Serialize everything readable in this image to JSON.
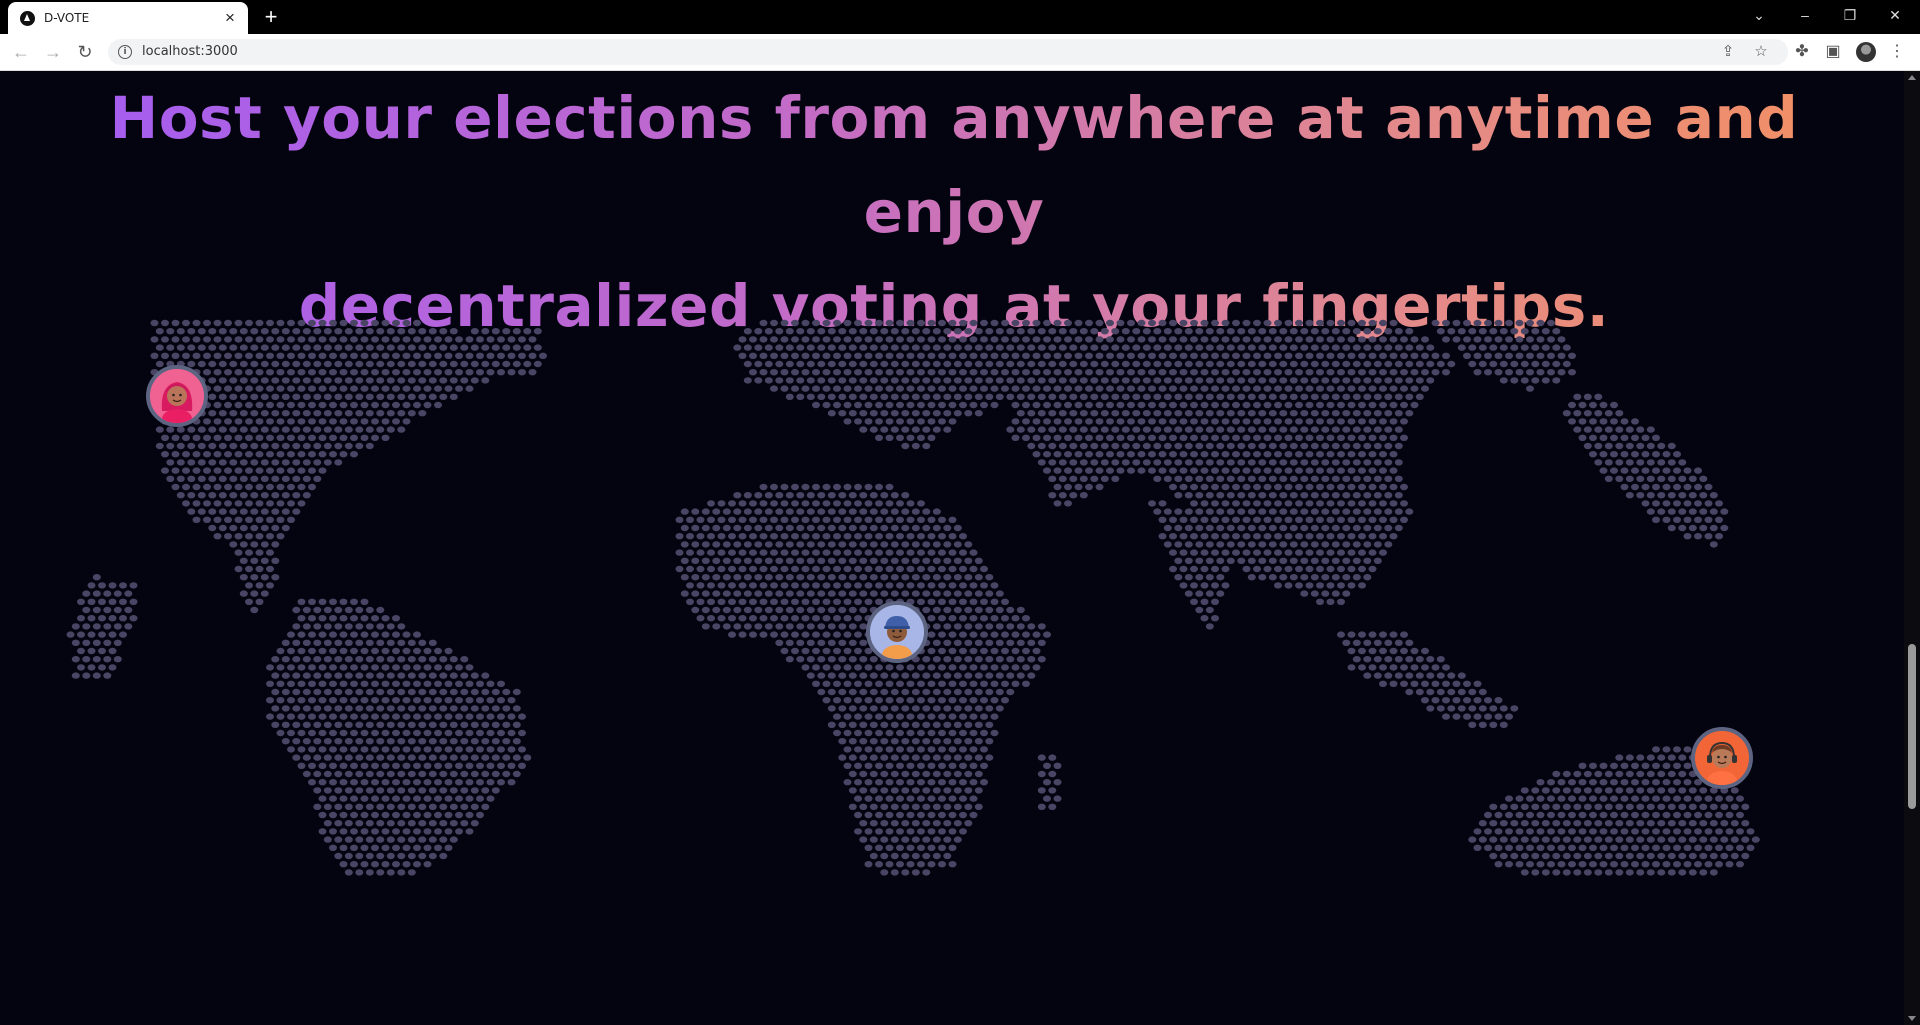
{
  "browser": {
    "tab_title": "D-VOTE",
    "new_tab_symbol": "+",
    "url": "localhost:3000",
    "icons": [
      "back-arrow-icon",
      "forward-arrow-icon",
      "reload-icon",
      "info-icon",
      "share-icon",
      "bookmark-star-icon",
      "extensions-puzzle-icon",
      "side-panel-icon",
      "profile-avatar-icon",
      "kebab-menu-icon",
      "chevron-down-icon",
      "minimize-icon",
      "restore-icon",
      "close-icon"
    ]
  },
  "hero": {
    "headline_line1": "Host your elections from anywhere at anytime and enjoy",
    "headline_line2": "decentralized voting at your fingertips."
  },
  "map": {
    "dot_color": "#4b4565",
    "avatars": [
      {
        "name": "voter-avatar-pink-hijab",
        "bg": "#f06292"
      },
      {
        "name": "voter-avatar-blue-cap",
        "bg": "#a7b6e6"
      },
      {
        "name": "voter-avatar-orange-headphones",
        "bg": "#f26536"
      }
    ]
  },
  "colors": {
    "background": "#03040f",
    "gradient_start": "#a35cf3",
    "gradient_end": "#f39060"
  }
}
